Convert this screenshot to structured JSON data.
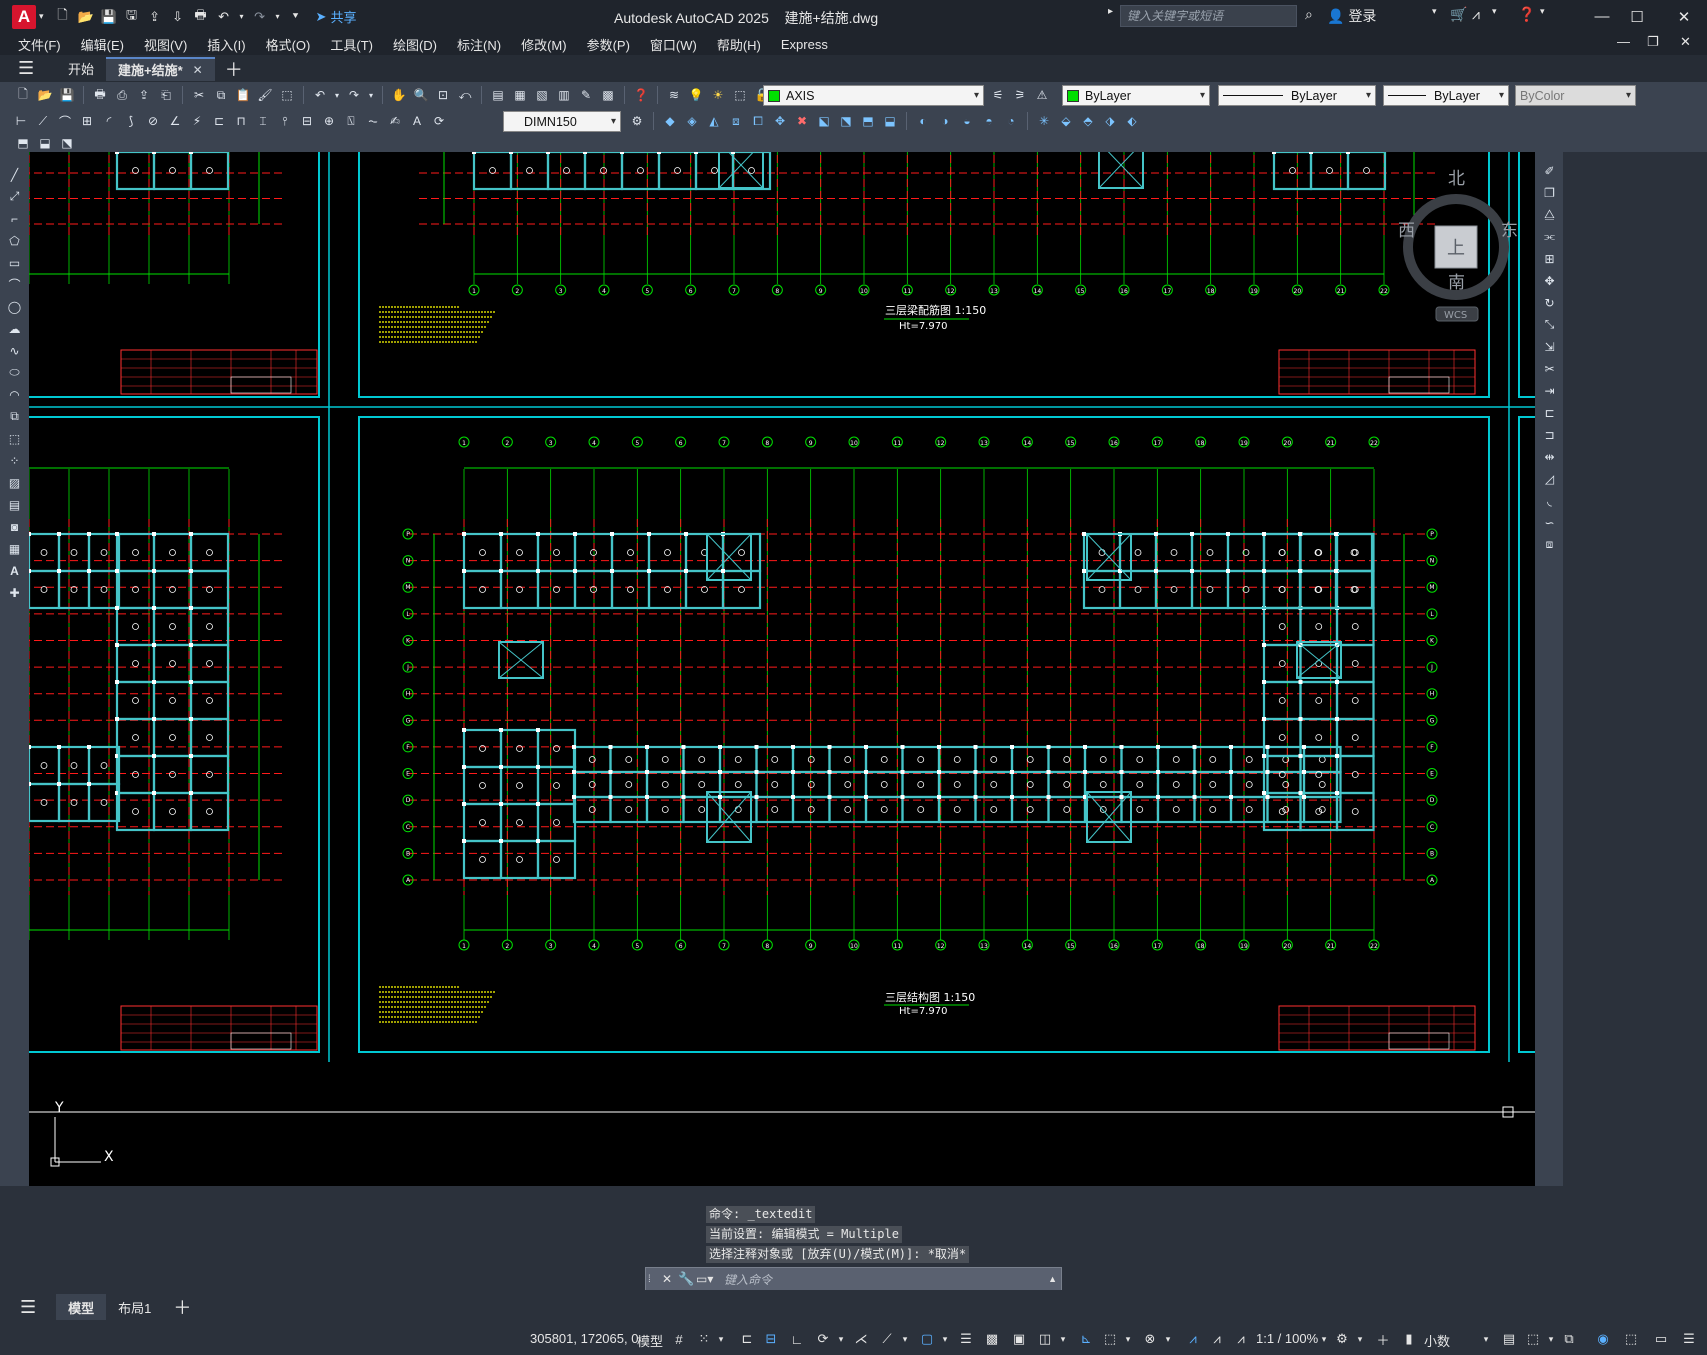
{
  "app": {
    "logo_letter": "A",
    "title": "Autodesk AutoCAD 2025    建施+结施.dwg",
    "share_label": "共享",
    "search_placeholder": "键入关键字或短语",
    "login_label": "登录"
  },
  "menu": [
    "文件(F)",
    "编辑(E)",
    "视图(V)",
    "插入(I)",
    "格式(O)",
    "工具(T)",
    "绘图(D)",
    "标注(N)",
    "修改(M)",
    "参数(P)",
    "窗口(W)",
    "帮助(H)",
    "Express"
  ],
  "tabs": [
    {
      "label": "开始",
      "active": false
    },
    {
      "label": "建施+结施*",
      "active": true
    }
  ],
  "toolbar": {
    "layer_name": "AXIS",
    "layer_color": "#00e000",
    "color_value": "ByLayer",
    "linetype_value": "ByLayer",
    "lineweight_value": "ByLayer",
    "plotstyle_value": "ByColor",
    "dimstyle_value": "DIMN150"
  },
  "viewcube": {
    "north": "北",
    "south": "南",
    "east": "东",
    "west": "西",
    "top": "上",
    "wcs": "WCS"
  },
  "drawing": {
    "top_sheet_title": "三层梁配筋图 1:150",
    "top_sheet_ht": "Ht=7.970",
    "bottom_sheet_title": "三层结构图  1:150",
    "bottom_sheet_ht": "Ht=7.970",
    "ucs_y": "Y",
    "ucs_x": "X",
    "grid_letters": [
      "P",
      "N",
      "M",
      "L",
      "K",
      "J",
      "H",
      "G",
      "F",
      "E",
      "D",
      "C",
      "B",
      "A"
    ],
    "grid_numbers": [
      "1",
      "2",
      "3",
      "4",
      "5",
      "6",
      "7",
      "8",
      "9",
      "10",
      "11",
      "12",
      "13",
      "14",
      "15",
      "16",
      "17",
      "18",
      "19",
      "20",
      "21",
      "22"
    ],
    "colors": {
      "sheet_border": "#00c8d2",
      "axis": "#00e000",
      "column_red": "#ff1a1a",
      "beam_cyan": "#45c4c8",
      "annotation": "#ffff00"
    }
  },
  "command": {
    "history": [
      "命令: _textedit",
      "当前设置: 编辑模式 = Multiple",
      "选择注释对象或 [放弃(U)/模式(M)]: *取消*"
    ],
    "input_placeholder": "键入命令"
  },
  "layouts": [
    {
      "label": "模型",
      "active": true
    },
    {
      "label": "布局1",
      "active": false
    }
  ],
  "status": {
    "coords": "305801, 172065, 0",
    "model_label": "模型",
    "scale": "1:1 / 100%",
    "units": "小数"
  }
}
